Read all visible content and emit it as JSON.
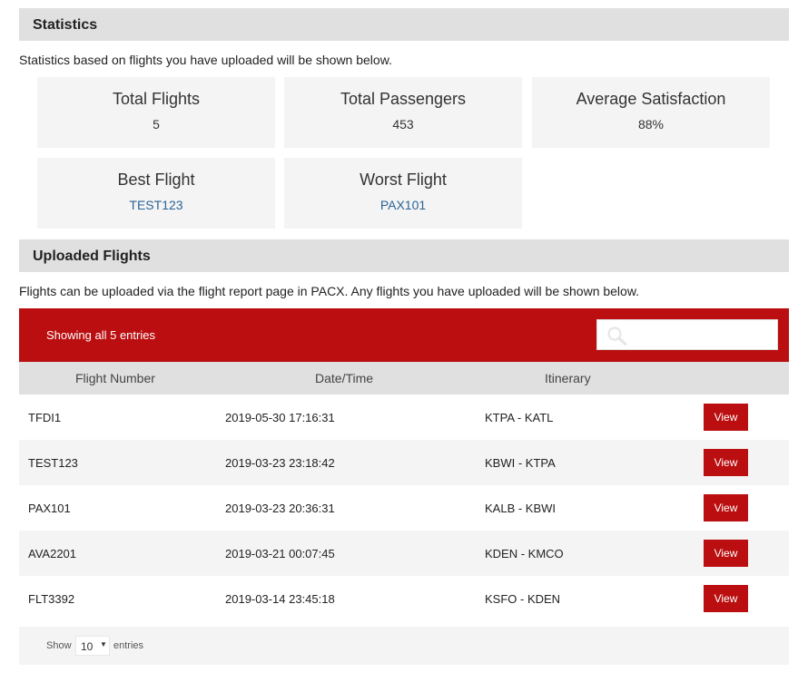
{
  "statistics": {
    "header": "Statistics",
    "description": "Statistics based on flights you have uploaded will be shown below.",
    "cards": [
      {
        "title": "Total Flights",
        "value": "5"
      },
      {
        "title": "Total Passengers",
        "value": "453"
      },
      {
        "title": "Average Satisfaction",
        "value": "88%"
      },
      {
        "title": "Best Flight",
        "value": "TEST123"
      },
      {
        "title": "Worst Flight",
        "value": "PAX101"
      }
    ]
  },
  "uploaded": {
    "header": "Uploaded Flights",
    "description": "Flights can be uploaded via the flight report page in PACX. Any flights you have uploaded will be shown below.",
    "showing_text": "Showing all 5 entries",
    "search": {
      "placeholder": "",
      "value": ""
    },
    "columns": [
      "Flight Number",
      "Date/Time",
      "Itinerary"
    ],
    "view_label": "View",
    "rows": [
      {
        "flight": "TFDI1",
        "datetime": "2019-05-30 17:16:31",
        "itinerary": "KTPA - KATL"
      },
      {
        "flight": "TEST123",
        "datetime": "2019-03-23 23:18:42",
        "itinerary": "KBWI - KTPA"
      },
      {
        "flight": "PAX101",
        "datetime": "2019-03-23 20:36:31",
        "itinerary": "KALB - KBWI"
      },
      {
        "flight": "AVA2201",
        "datetime": "2019-03-21 00:07:45",
        "itinerary": "KDEN - KMCO"
      },
      {
        "flight": "FLT3392",
        "datetime": "2019-03-14 23:45:18",
        "itinerary": "KSFO - KDEN"
      }
    ],
    "footer": {
      "show_label": "Show",
      "entries_value": "10",
      "entries_label": "entries"
    }
  },
  "colors": {
    "accent": "#bb0e10",
    "link": "#2a6496",
    "header_bg": "#e0e0e0",
    "card_bg": "#f4f4f4"
  },
  "icons": {
    "search": "search-icon",
    "caret": "caret-down-icon"
  }
}
